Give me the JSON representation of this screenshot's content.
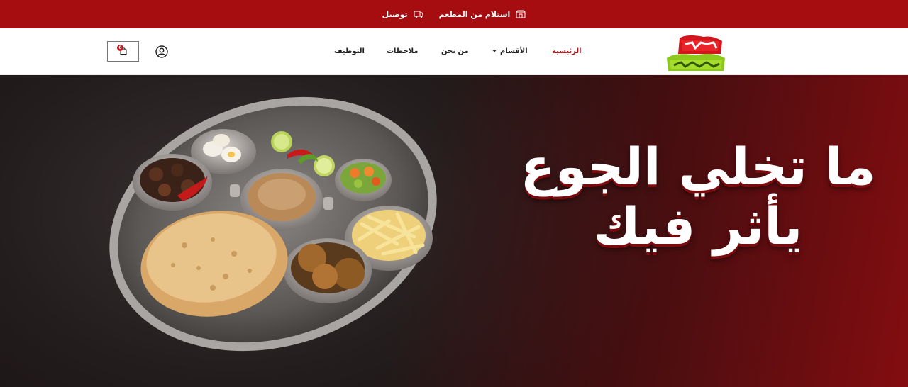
{
  "topbar": {
    "options": [
      {
        "label": "استلام من المطعم",
        "icon": "store-icon"
      },
      {
        "label": "توصيل",
        "icon": "delivery-icon"
      }
    ]
  },
  "header": {
    "logo_icon": "brand-logo",
    "nav": {
      "home": "الرئيسية",
      "categories": "الأقسام",
      "about": "من نحن",
      "notes": "ملاحظات",
      "jobs": "التوظيف"
    },
    "cart_count": "0",
    "user_icon": "user-icon",
    "cart_icon": "shopping-bag-icon"
  },
  "hero": {
    "headline_line1": "ما تخلي الجوع",
    "headline_line2": "يأثر فيك"
  },
  "colors": {
    "brand_red": "#a50d10",
    "active_nav": "#b3141a",
    "logo_green": "#7fc31c"
  }
}
